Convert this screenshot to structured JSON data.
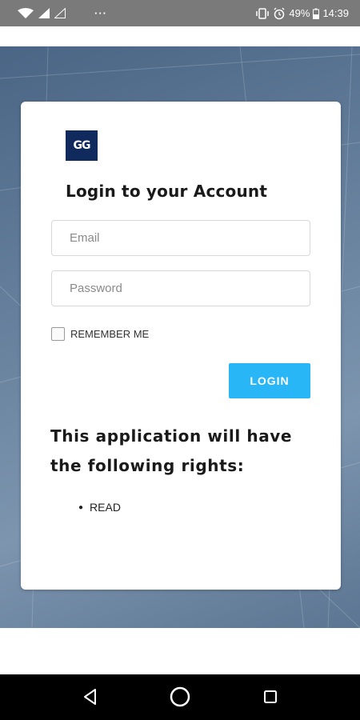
{
  "status_bar": {
    "overflow": "···",
    "battery": "49%",
    "time": "14:39"
  },
  "logo": {
    "text": "GG"
  },
  "login": {
    "title": "Login to your Account",
    "email_placeholder": "Email",
    "password_placeholder": "Password",
    "remember_label": "REMEMBER ME",
    "button_label": "LOGIN"
  },
  "rights": {
    "heading": "This application will have the following rights:",
    "items": [
      "READ"
    ]
  },
  "colors": {
    "accent": "#29b6f6",
    "logo_bg": "#102a5e",
    "status_bar": "#7a7a7a",
    "background": "#5f7a97"
  }
}
